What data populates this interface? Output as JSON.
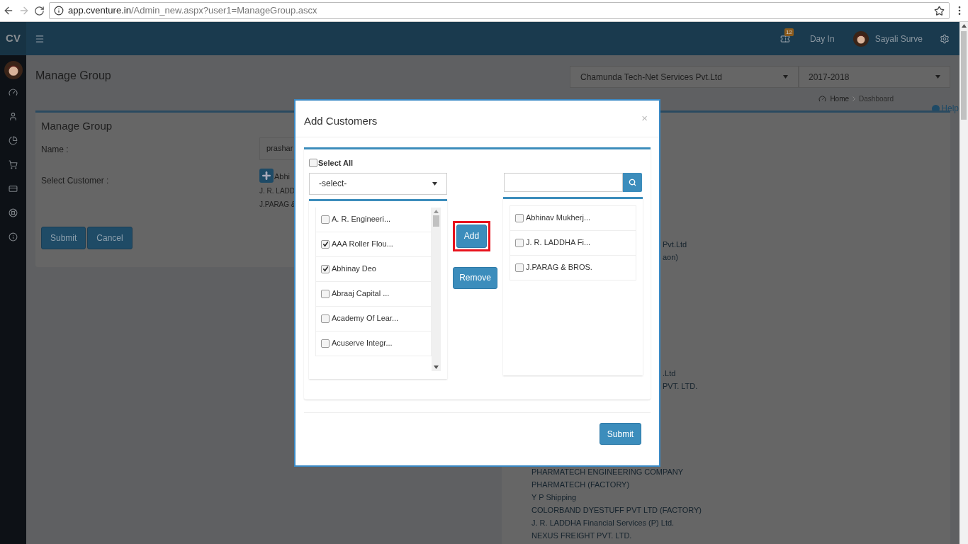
{
  "browser": {
    "url_host": "app.cventure.in",
    "url_path": "/Admin_new.aspx?user1=ManageGroup.ascx"
  },
  "header": {
    "logo": "CV",
    "notification_count": "12",
    "day_in": "Day In",
    "user_name": "Sayali Surve"
  },
  "page": {
    "title": "Manage Group",
    "company_select": "Chamunda Tech-Net Services Pvt.Ltd",
    "year_select": "2017-2018",
    "breadcrumb": [
      "Home",
      "Dashboard"
    ],
    "help": "Help"
  },
  "form": {
    "title": "Manage Group",
    "name_label": "Name :",
    "name_value": "prashar",
    "customer_label": "Select Customer :",
    "selected_customers": [
      "Abhi",
      "J. R. LADD",
      "J.PARAG &"
    ],
    "buttons": [
      "Submit",
      "Cancel"
    ]
  },
  "customer_list": {
    "groups": [
      {
        "items": [
          "Pvt.Ltd",
          "aon)"
        ]
      },
      {
        "items": [
          ".Ltd",
          "PVT. LTD."
        ]
      },
      {
        "items": [
          "PHARMATECH ENGINEERING COMPANY",
          "PHARMATECH (FACTORY)",
          "Y P Shipping",
          "COLORBAND DYESTUFF PVT LTD (FACTORY)",
          "J. R. LADDHA Financial Services (P) Ltd.",
          "NEXUS FREIGHT PVT. LTD."
        ]
      }
    ]
  },
  "modal": {
    "title": "Add Customers",
    "close": "×",
    "select_all": {
      "label": "Select All",
      "checked": false
    },
    "filter_select": "-select-",
    "available": [
      {
        "name": "A. R. Engineeri...",
        "checked": false
      },
      {
        "name": "AAA Roller Flou...",
        "checked": true
      },
      {
        "name": "Abhinay Deo",
        "checked": true
      },
      {
        "name": "Abraaj Capital ...",
        "checked": false
      },
      {
        "name": "Academy Of Lear...",
        "checked": false
      },
      {
        "name": "Acuserve Integr...",
        "checked": false
      }
    ],
    "add_button": {
      "label": "Add",
      "highlighted": true
    },
    "remove_button": {
      "label": "Remove",
      "highlighted": false
    },
    "chosen": [
      {
        "name": "Abhinav Mukherj...",
        "checked": false
      },
      {
        "name": "J. R. LADDHA Fi...",
        "checked": false
      },
      {
        "name": "J.PARAG & BROS.",
        "checked": false
      }
    ],
    "submit": "Submit"
  }
}
